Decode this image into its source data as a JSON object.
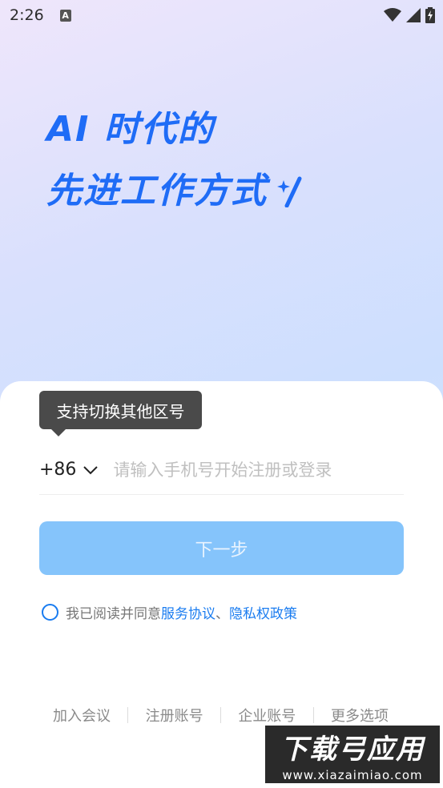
{
  "status_bar": {
    "time": "2:26",
    "notification_icon": "a-icon",
    "wifi_icon": "wifi-icon",
    "signal_icon": "signal-icon",
    "battery_icon": "battery-charging-icon"
  },
  "hero": {
    "line1": "AI 时代的",
    "line2": "先进工作方式",
    "accent_color": "#1f6cf6"
  },
  "tooltip": {
    "text": "支持切换其他区号"
  },
  "phone": {
    "country_code": "+86",
    "placeholder": "请输入手机号开始注册或登录",
    "value": ""
  },
  "next_button": {
    "label": "下一步",
    "color": "#85c4fb"
  },
  "agreement": {
    "prefix": "我已阅读并同意",
    "service_link": "服务协议",
    "separator": "、",
    "privacy_link": "隐私权政策",
    "link_color": "#1a7cf0"
  },
  "bottom_links": [
    "加入会议",
    "注册账号",
    "企业账号",
    "更多选项"
  ],
  "watermark": {
    "main": "下载弓应用",
    "sub": "www.xiazaimiao.com"
  }
}
